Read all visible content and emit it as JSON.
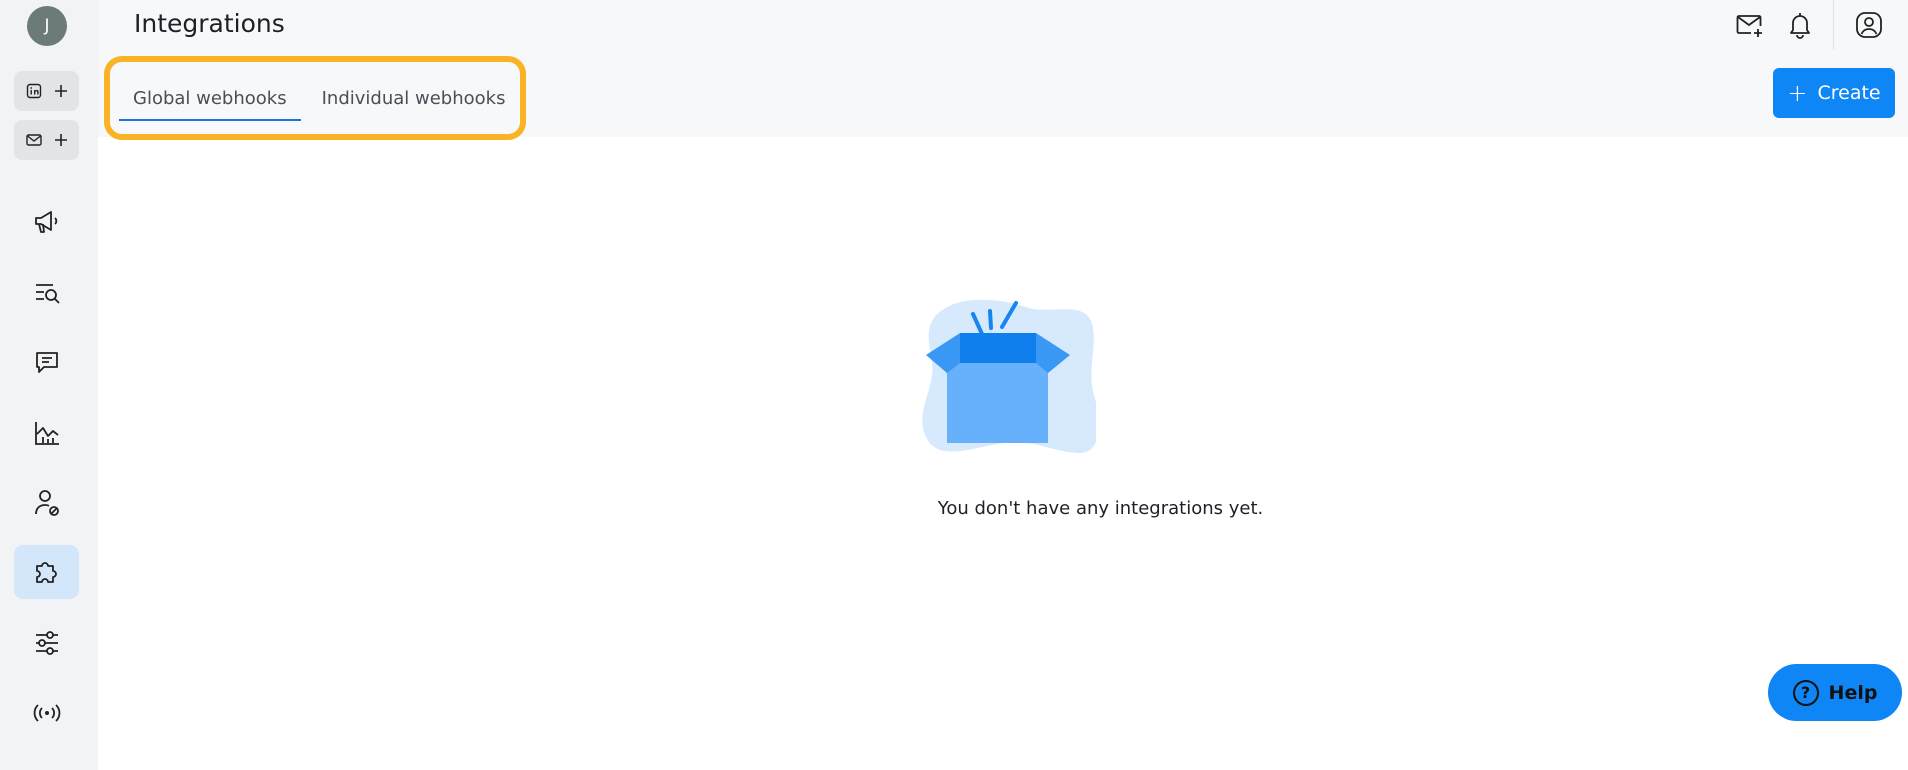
{
  "sidebar": {
    "avatar_initial": "J",
    "add_linkedin_icon": "linkedin-plus-icon",
    "add_email_icon": "email-plus-icon",
    "items": [
      {
        "name": "campaigns",
        "icon": "megaphone-icon"
      },
      {
        "name": "search",
        "icon": "list-search-icon"
      },
      {
        "name": "inbox",
        "icon": "message-icon"
      },
      {
        "name": "analytics",
        "icon": "chart-line-icon"
      },
      {
        "name": "blacklist",
        "icon": "user-block-icon"
      },
      {
        "name": "integrations",
        "icon": "puzzle-icon",
        "active": true
      },
      {
        "name": "settings",
        "icon": "sliders-icon"
      },
      {
        "name": "webhooks",
        "icon": "broadcast-icon"
      }
    ]
  },
  "header": {
    "title": "Integrations",
    "icons": [
      "mail-plus-icon",
      "bell-icon",
      "user-circle-icon"
    ]
  },
  "tabs": [
    {
      "label": "Global webhooks",
      "active": true
    },
    {
      "label": "Individual webhooks",
      "active": false
    }
  ],
  "create_button": {
    "label": "Create"
  },
  "empty_state": {
    "message": "You don't have any integrations yet."
  },
  "help_button": {
    "label": "Help"
  },
  "colors": {
    "accent": "#0f86f5",
    "highlight": "#f9b325",
    "tab_underline": "#1a73d9"
  }
}
